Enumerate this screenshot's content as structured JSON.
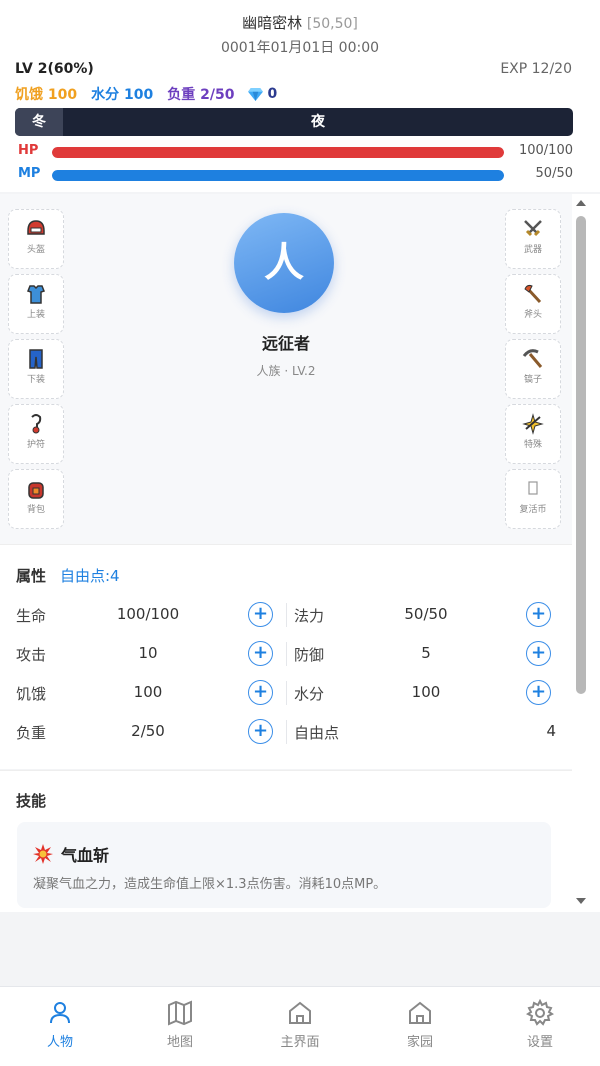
{
  "header": {
    "location": "幽暗密林",
    "coords": "[50,50]",
    "datetime": "0001年01月01日 00:00",
    "level": "LV 2(60%)",
    "exp": "EXP 12/20",
    "hunger": "饥饿 100",
    "water": "水分 100",
    "load": "负重 2/50",
    "gems": "0",
    "season": "冬",
    "time_of_day": "夜",
    "hp": {
      "label": "HP",
      "value": "100/100",
      "fraction": 1.0
    },
    "mp": {
      "label": "MP",
      "value": "50/50",
      "fraction": 1.0
    }
  },
  "equipment": {
    "left": [
      {
        "label": "头盔",
        "icon": "helmet-icon"
      },
      {
        "label": "上装",
        "icon": "top-armor-icon"
      },
      {
        "label": "下装",
        "icon": "pants-icon"
      },
      {
        "label": "护符",
        "icon": "amulet-icon"
      },
      {
        "label": "背包",
        "icon": "backpack-icon"
      }
    ],
    "right": [
      {
        "label": "武器",
        "icon": "crossed-swords-icon"
      },
      {
        "label": "斧头",
        "icon": "axe-icon"
      },
      {
        "label": "镐子",
        "icon": "pickaxe-icon"
      },
      {
        "label": "特殊",
        "icon": "sparkle-icon"
      },
      {
        "label": "复活币",
        "icon": "coin-slot-icon"
      }
    ]
  },
  "character": {
    "avatar_char": "人",
    "name": "远征者",
    "subtitle": "人族 · LV.2"
  },
  "attributes": {
    "title": "属性",
    "free_points_label": "自由点:4",
    "rows": [
      {
        "left_name": "生命",
        "left_value": "100/100",
        "right_name": "法力",
        "right_value": "50/50"
      },
      {
        "left_name": "攻击",
        "left_value": "10",
        "right_name": "防御",
        "right_value": "5"
      },
      {
        "left_name": "饥饿",
        "left_value": "100",
        "right_name": "水分",
        "right_value": "100"
      },
      {
        "left_name": "负重",
        "left_value": "2/50",
        "right_name": "自由点",
        "right_value": "4"
      }
    ],
    "plus": "+"
  },
  "skills": {
    "title": "技能",
    "items": [
      {
        "name": "气血斩",
        "icon": "explosion-icon",
        "desc": "凝聚气血之力，造成生命值上限×1.3点伤害。消耗10点MP。"
      }
    ]
  },
  "nav": {
    "items": [
      {
        "label": "人物",
        "icon": "user-icon"
      },
      {
        "label": "地图",
        "icon": "map-icon"
      },
      {
        "label": "主界面",
        "icon": "home-icon"
      },
      {
        "label": "家园",
        "icon": "home-icon"
      },
      {
        "label": "设置",
        "icon": "gear-icon"
      }
    ]
  },
  "colors": {
    "accent": "#1e80e0",
    "hp": "#e03a3a",
    "hunger": "#f0a020",
    "load": "#6d3fbf"
  }
}
